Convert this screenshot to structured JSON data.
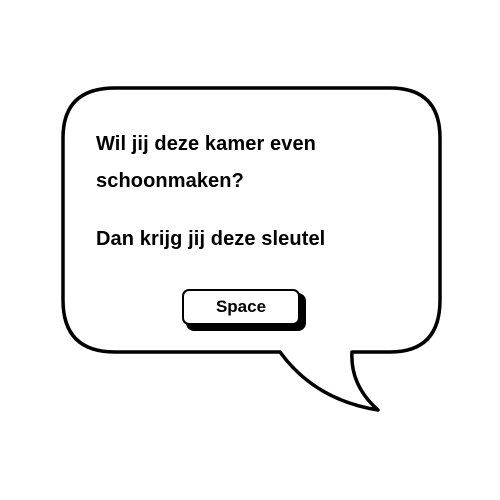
{
  "dialog": {
    "line1": "Wil jij deze kamer even",
    "line2": "schoonmaken?",
    "line3": "Dan krijg jij deze sleutel"
  },
  "prompt": {
    "key_label": "Space"
  },
  "colors": {
    "bubble_fill": "#ffffff",
    "outline": "#000000",
    "text": "#000000"
  }
}
